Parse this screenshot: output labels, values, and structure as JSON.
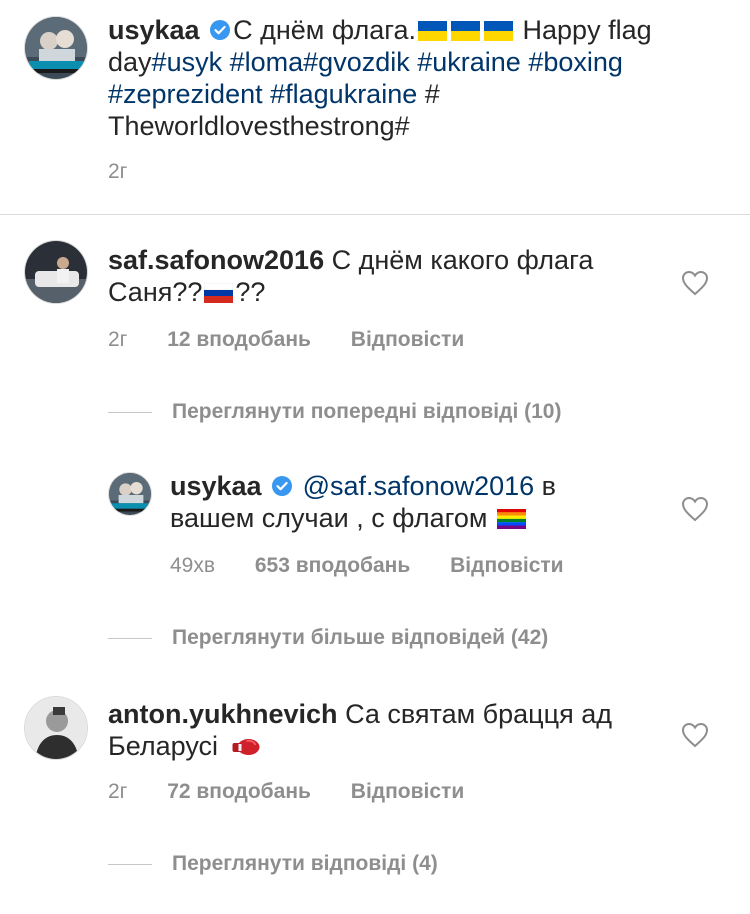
{
  "caption": {
    "username": "usykaa",
    "text_before_flags": "С днём флага.",
    "text_after_flags": " Happy flag day",
    "hashtags_line1": [
      "#usyk",
      " ",
      "#loma",
      "#gvozdik",
      " ",
      "#ukraine",
      " ",
      "#boxing"
    ],
    "hashtags_line2": [
      "#zeprezident",
      " ",
      "#flagukraine",
      " #"
    ],
    "last_line": "Theworldlovesthestrong#",
    "time": "2г"
  },
  "comments": [
    {
      "username": "saf.safonow2016",
      "text_line1": "С днём какого флага",
      "text_line2_before": "Саня??",
      "text_line2_after": "??",
      "time": "2г",
      "likes": "12 вподобань",
      "reply": "Відповісти",
      "view_replies": "Переглянути попередні відповіді (10)"
    },
    {
      "username": "usykaa",
      "mention": "@saf.safonow2016",
      "text_line1_after": " в",
      "text_line2": "вашем случаи , с флагом",
      "time": "49хв",
      "likes": "653 вподобань",
      "reply": "Відповісти",
      "view_replies": "Переглянути більше відповідей (42)"
    },
    {
      "username": "anton.yukhnevich",
      "text_line1": "Са святам брацця ад",
      "text_line2": "Беларусі",
      "time": "2г",
      "likes": "72 вподобань",
      "reply": "Відповісти",
      "view_replies": "Переглянути відповіді (4)"
    }
  ],
  "colors": {
    "text": "#262626",
    "link": "#003569",
    "meta": "#8e8e8e",
    "verified": "#3897f0",
    "ukraine_blue": "#0057b7",
    "ukraine_yellow": "#ffd700"
  }
}
